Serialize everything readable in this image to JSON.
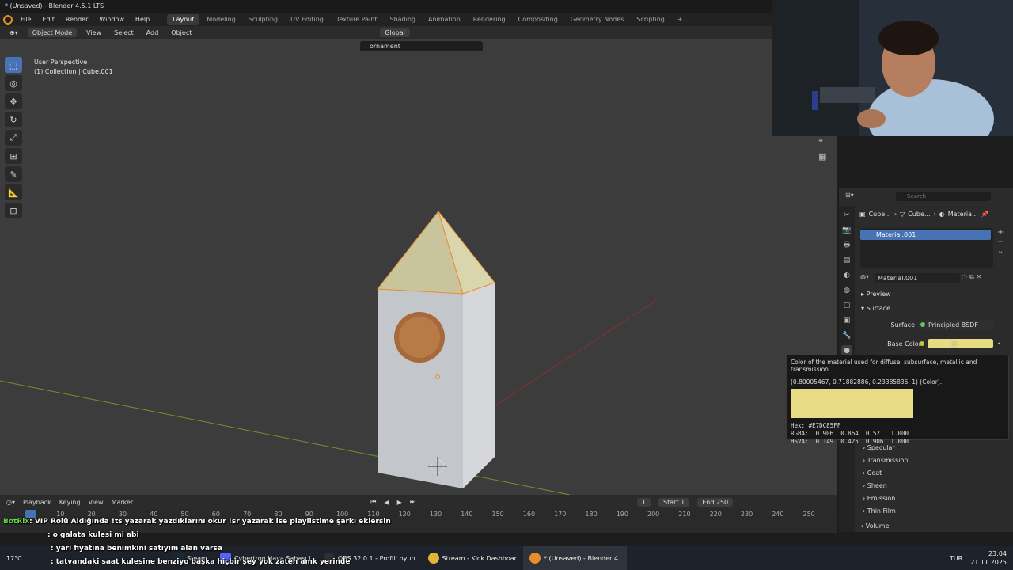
{
  "window": {
    "title": "* (Unsaved) - Blender 4.5.1 LTS",
    "version": "4.5.1"
  },
  "menu": {
    "items": [
      "File",
      "Edit",
      "Render",
      "Window",
      "Help"
    ]
  },
  "workspaces": [
    "Layout",
    "Modeling",
    "Sculpting",
    "UV Editing",
    "Texture Paint",
    "Shading",
    "Animation",
    "Rendering",
    "Compositing",
    "Geometry Nodes",
    "Scripting"
  ],
  "active_workspace": "Layout",
  "viewport_header": {
    "mode": "Object Mode",
    "menus": [
      "View",
      "Select",
      "Add",
      "Object"
    ],
    "transform": "Global",
    "search_value": "ornament"
  },
  "viewport": {
    "perspective": "User Perspective",
    "collection": "(1) Collection | Cube.001"
  },
  "timeline": {
    "menus": [
      "Playback",
      "Keying",
      "View",
      "Marker"
    ],
    "current_frame": "1",
    "start_label": "Start",
    "start": "1",
    "end_label": "End",
    "end": "250",
    "ticks": [
      "0",
      "10",
      "20",
      "30",
      "40",
      "50",
      "60",
      "70",
      "80",
      "90",
      "100",
      "110",
      "120",
      "130",
      "140",
      "150",
      "160",
      "170",
      "180",
      "190",
      "200",
      "210",
      "220",
      "230",
      "240",
      "250"
    ]
  },
  "properties": {
    "search_placeholder": "Search",
    "breadcrumb": [
      "Cube...",
      "Cube...",
      "Materia..."
    ],
    "material_slot": "Material.001",
    "material_name": "Material.001",
    "panels": {
      "preview": "Preview",
      "surface": "Surface"
    },
    "surface_label": "Surface",
    "surface_value": "Principled BSDF",
    "base_color_label": "Base Color",
    "base_color_hex": "#E7DC85",
    "subpanels": [
      "Specular",
      "Transmission",
      "Coat",
      "Sheen",
      "Emission",
      "Thin Film"
    ],
    "volume": "Volume"
  },
  "tooltip": {
    "description": "Color of the material used for diffuse, subsurface, metallic and transmission.",
    "python": "(0.80005467, 0.71882886, 0.23385836, 1) (Color).",
    "hex": "Hex: #E7DC85FF",
    "rgba": "RGBA:  0.906  0.864  0.521  1.000",
    "hsva": "HSVA:  0.149  0.425  0.906  1.000"
  },
  "chat": [
    {
      "user": "BotRix",
      "text": ": VIP Rolü Aldığında !ts yazarak yazdıklarını okur !sr yazarak ise playlistime şarkı eklersin"
    },
    {
      "user": "",
      "text": ": o galata kulesi mi abi"
    },
    {
      "user": "",
      "text": ": yarı fiyatına benimkini satıyım alan varsa"
    },
    {
      "user": "",
      "text": ": tatvandaki saat kulesine benziyo başka hiçbir şey yok zaten amk yerinde"
    }
  ],
  "taskbar": {
    "items": [
      "Steam",
      "Cybertron Hava Sahası |",
      "OBS 32.0.1 - Profil: oyun",
      "Stream - Kick Dashboar",
      "* (Unsaved) - Blender 4."
    ],
    "language": "TUR",
    "time": "23:04",
    "date": "21.11.2025",
    "weather": "17°C"
  },
  "colors": {
    "accent": "#4772b3",
    "selection": "#e98d2b",
    "base_color": "#e7dc85"
  }
}
